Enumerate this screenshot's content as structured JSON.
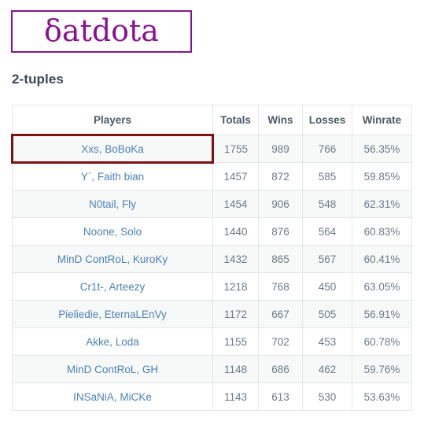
{
  "site": {
    "logo_text": "δatdota",
    "logo_color": "#8a128f"
  },
  "page": {
    "heading": "2-tuples"
  },
  "table": {
    "columns": [
      "Players",
      "Totals",
      "Wins",
      "Losses",
      "Winrate"
    ],
    "highlight_color": "#7d1212",
    "link_color": "#4d82b8",
    "rows": [
      {
        "players": "Xxs, BoBoKa",
        "totals": "1755",
        "wins": "989",
        "losses": "766",
        "winrate": "56.35%",
        "highlighted": true
      },
      {
        "players": "Y`, Faith bian",
        "totals": "1457",
        "wins": "872",
        "losses": "585",
        "winrate": "59.85%",
        "highlighted": false
      },
      {
        "players": "N0tail, Fly",
        "totals": "1454",
        "wins": "906",
        "losses": "548",
        "winrate": "62.31%",
        "highlighted": false
      },
      {
        "players": "Noone, Solo",
        "totals": "1440",
        "wins": "876",
        "losses": "564",
        "winrate": "60.83%",
        "highlighted": false
      },
      {
        "players": "MinD ContRoL, KuroKy",
        "totals": "1432",
        "wins": "865",
        "losses": "567",
        "winrate": "60.41%",
        "highlighted": false
      },
      {
        "players": "Cr1t-, Arteezy",
        "totals": "1218",
        "wins": "768",
        "losses": "450",
        "winrate": "63.05%",
        "highlighted": false
      },
      {
        "players": "Pieliedie, EternaLEnVy",
        "totals": "1172",
        "wins": "667",
        "losses": "505",
        "winrate": "56.91%",
        "highlighted": false
      },
      {
        "players": "Akke, Loda",
        "totals": "1155",
        "wins": "702",
        "losses": "453",
        "winrate": "60.78%",
        "highlighted": false
      },
      {
        "players": "MinD ContRoL, GH",
        "totals": "1148",
        "wins": "686",
        "losses": "462",
        "winrate": "59.76%",
        "highlighted": false
      },
      {
        "players": "INSaNiA, MiCKe",
        "totals": "1143",
        "wins": "613",
        "losses": "530",
        "winrate": "53.63%",
        "highlighted": false
      }
    ]
  }
}
